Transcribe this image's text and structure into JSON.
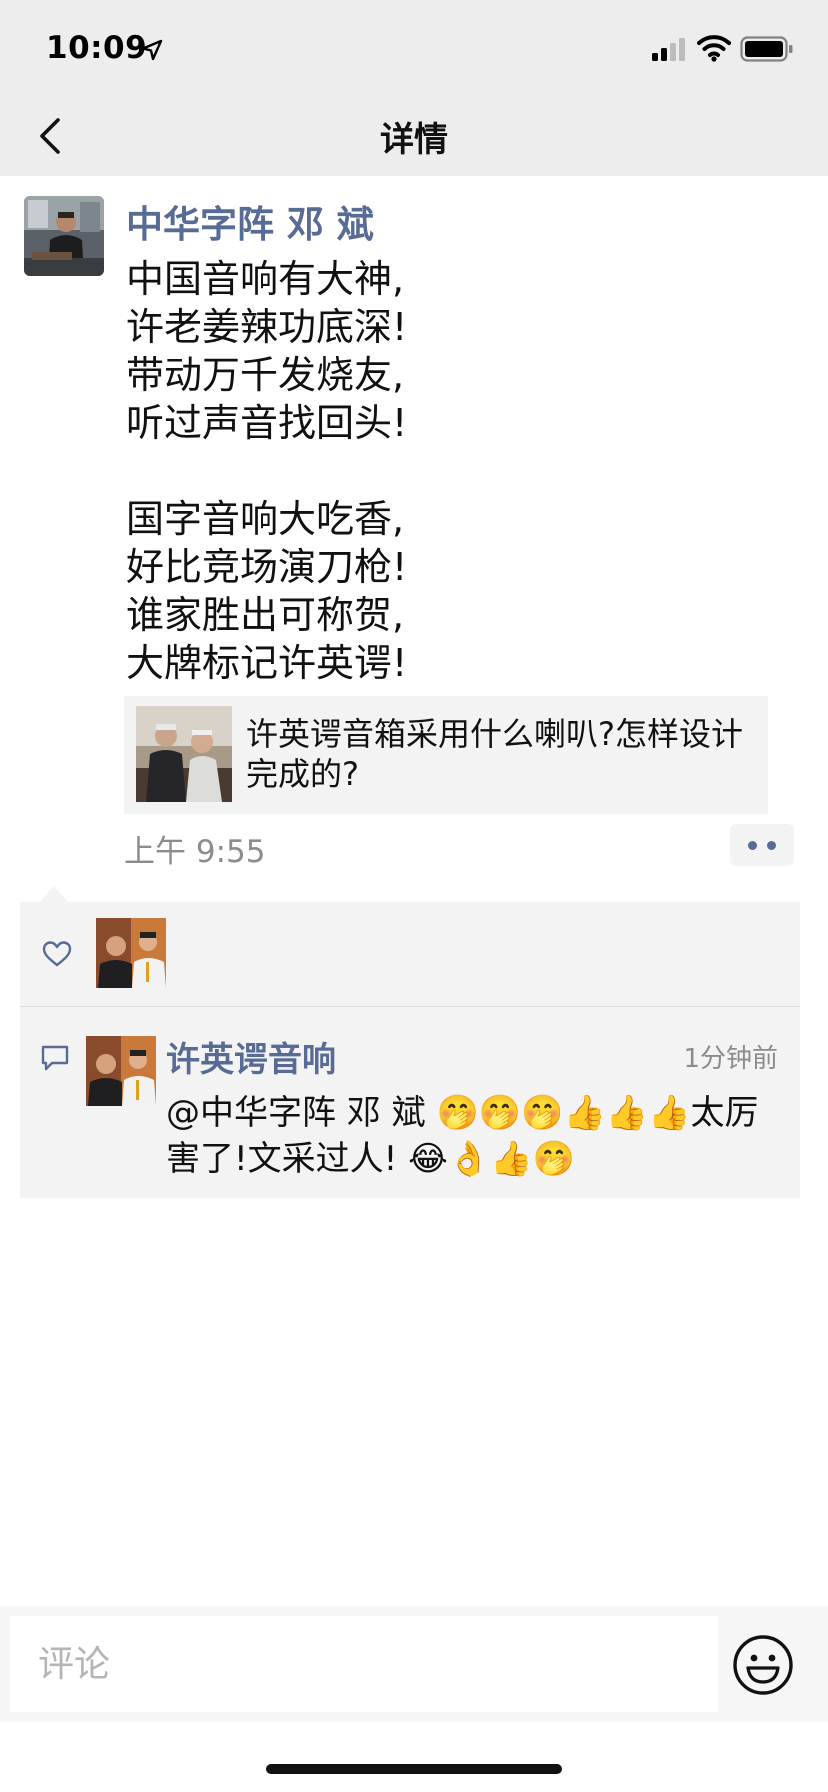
{
  "status_bar": {
    "time": "10:09",
    "icons": [
      "location-arrow-icon",
      "signal-icon",
      "wifi-icon",
      "battery-icon"
    ]
  },
  "nav": {
    "title": "详情",
    "back_icon": "chevron-left-icon"
  },
  "post": {
    "author": "中华字阵 邓 斌",
    "lines": [
      "中国音响有大神,",
      "许老姜辣功底深!",
      "带动万千发烧友,",
      "听过声音找回头!",
      "",
      "国字音响大吃香,",
      "好比竞场演刀枪!",
      "谁家胜出可称贺,",
      "大牌标记许英谔!"
    ],
    "shared_link": {
      "title": "许英谔音箱采用什么喇叭?怎样设计完成的?"
    },
    "time": "上午 9:55",
    "more_icon": "more-dots-icon"
  },
  "likes": {
    "icon": "heart-outline-icon"
  },
  "comments": [
    {
      "author": "许英谔音响",
      "time": "1分钟前",
      "mention": "@中华字阵 邓 斌",
      "text_part1": "🤭🤭🤭👍👍👍太厉害了!文采过人!",
      "text_part2": "😂👌👍🤭"
    }
  ],
  "input": {
    "placeholder": "评论",
    "emoji_icon": "smiley-face-icon"
  },
  "colors": {
    "bar_bg": "#ededed",
    "link_blue": "#576b95",
    "panel_bg": "#f3f3f3",
    "muted_text": "#8c8c8c"
  }
}
